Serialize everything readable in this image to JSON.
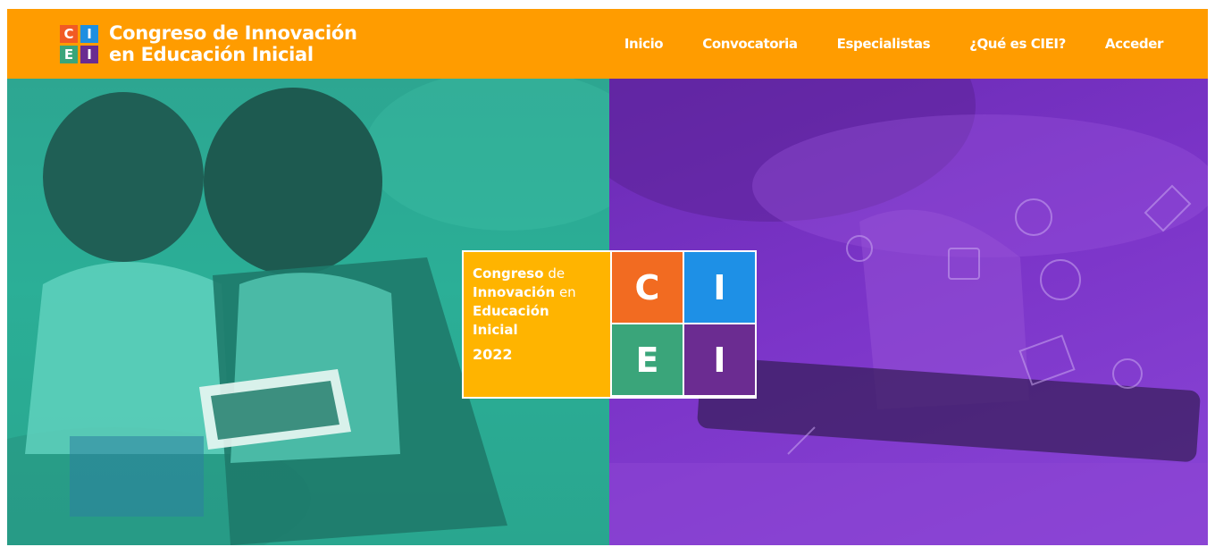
{
  "brand": {
    "letters": [
      "C",
      "I",
      "E",
      "I"
    ],
    "colors": [
      "#f15a24",
      "#1d8fe1",
      "#3aa57a",
      "#6a2c91"
    ],
    "title_line1": "Congreso de Innovación",
    "title_line2": "en Educación Inicial"
  },
  "nav": {
    "items": [
      {
        "label": "Inicio"
      },
      {
        "label": "Convocatoria"
      },
      {
        "label": "Especialistas"
      },
      {
        "label": "¿Qué es CIEI?"
      },
      {
        "label": "Acceder"
      }
    ]
  },
  "hero": {
    "logo": {
      "line1_bold": "Congreso",
      "line1_light": " de",
      "line2_bold": "Innovación",
      "line2_light": " en",
      "line3_bold": "Educación",
      "line4_bold": "Inicial",
      "year": "2022",
      "letters": [
        "C",
        "I",
        "E",
        "I"
      ],
      "colors": [
        "#f26b21",
        "#1e90e6",
        "#3aa57a",
        "#6b2c91"
      ]
    }
  },
  "colors": {
    "header_bg": "#ff9c00",
    "left_panel": "#2bb59b",
    "right_panel": "#7b34c8",
    "logo_text_bg": "#ffb400"
  }
}
